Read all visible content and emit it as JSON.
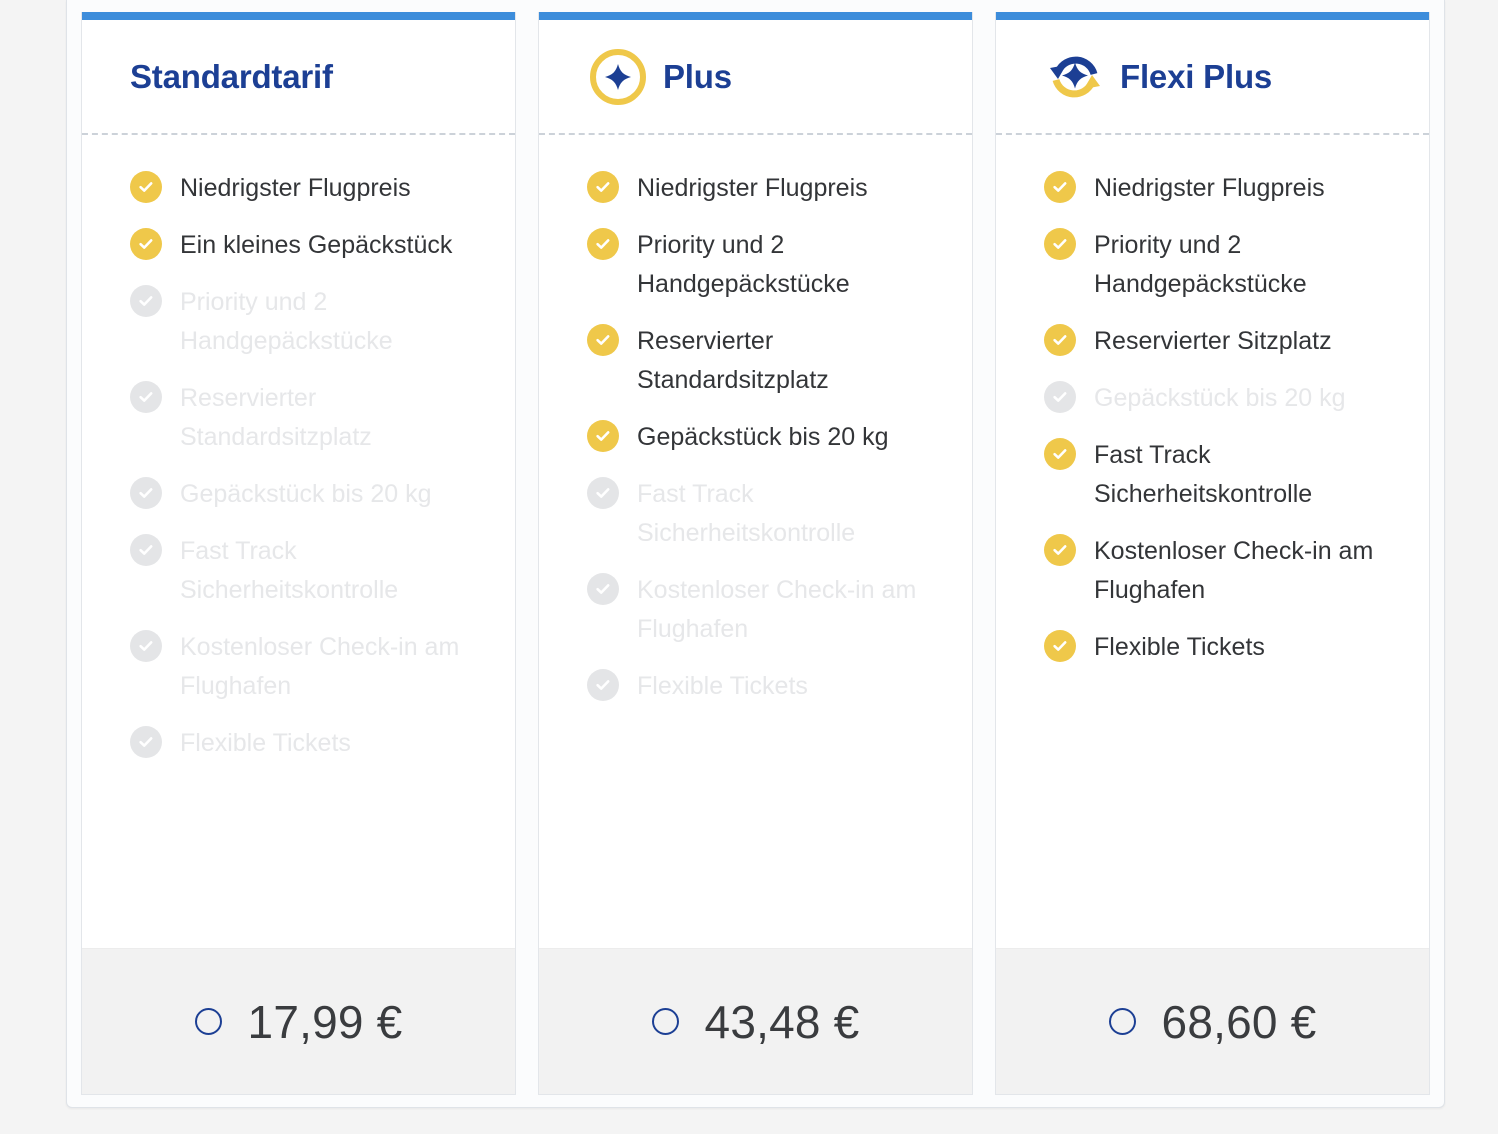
{
  "widget": {
    "accent_bar_color": "#3d8ddb",
    "title_color": "#1c3f94",
    "check_active_color": "#efc84a",
    "check_disabled_color": "#e4e5e7",
    "footer_background": "#f2f2f2"
  },
  "fares": [
    {
      "id": "standardtarif",
      "title": "Standardtarif",
      "icon": "none",
      "features": [
        {
          "label": "Niedrigster Flugpreis",
          "included": true
        },
        {
          "label": "Ein kleines Gepäckstück",
          "included": true
        },
        {
          "label": "Priority und 2 Handgepäckstücke",
          "included": false
        },
        {
          "label": "Reservierter Standardsitzplatz",
          "included": false
        },
        {
          "label": "Gepäckstück bis 20 kg",
          "included": false
        },
        {
          "label": "Fast Track Sicherheitskontrolle",
          "included": false
        },
        {
          "label": "Kostenloser Check-in am Flughafen",
          "included": false
        },
        {
          "label": "Flexible Tickets",
          "included": false
        }
      ],
      "price": "17,99 €",
      "selected": false
    },
    {
      "id": "plus",
      "title": "Plus",
      "icon": "plus-circle-icon",
      "features": [
        {
          "label": "Niedrigster Flugpreis",
          "included": true
        },
        {
          "label": "Priority und 2 Handgepäckstücke",
          "included": true
        },
        {
          "label": "Reservierter Standardsitzplatz",
          "included": true
        },
        {
          "label": "Gepäckstück bis 20 kg",
          "included": true
        },
        {
          "label": "Fast Track Sicherheitskontrolle",
          "included": false
        },
        {
          "label": "Kostenloser Check-in am Flughafen",
          "included": false
        },
        {
          "label": "Flexible Tickets",
          "included": false
        }
      ],
      "price": "43,48 €",
      "selected": false
    },
    {
      "id": "flexi-plus",
      "title": "Flexi Plus",
      "icon": "flexi-sync-plus-icon",
      "features": [
        {
          "label": "Niedrigster Flugpreis",
          "included": true
        },
        {
          "label": "Priority und 2 Handgepäckstücke",
          "included": true
        },
        {
          "label": "Reservierter Sitzplatz",
          "included": true
        },
        {
          "label": "Gepäckstück bis 20 kg",
          "included": false
        },
        {
          "label": "Fast Track Sicherheitskontrolle",
          "included": true
        },
        {
          "label": "Kostenloser Check-in am Flughafen",
          "included": true
        },
        {
          "label": "Flexible Tickets",
          "included": true
        }
      ],
      "price": "68,60 €",
      "selected": false
    }
  ]
}
